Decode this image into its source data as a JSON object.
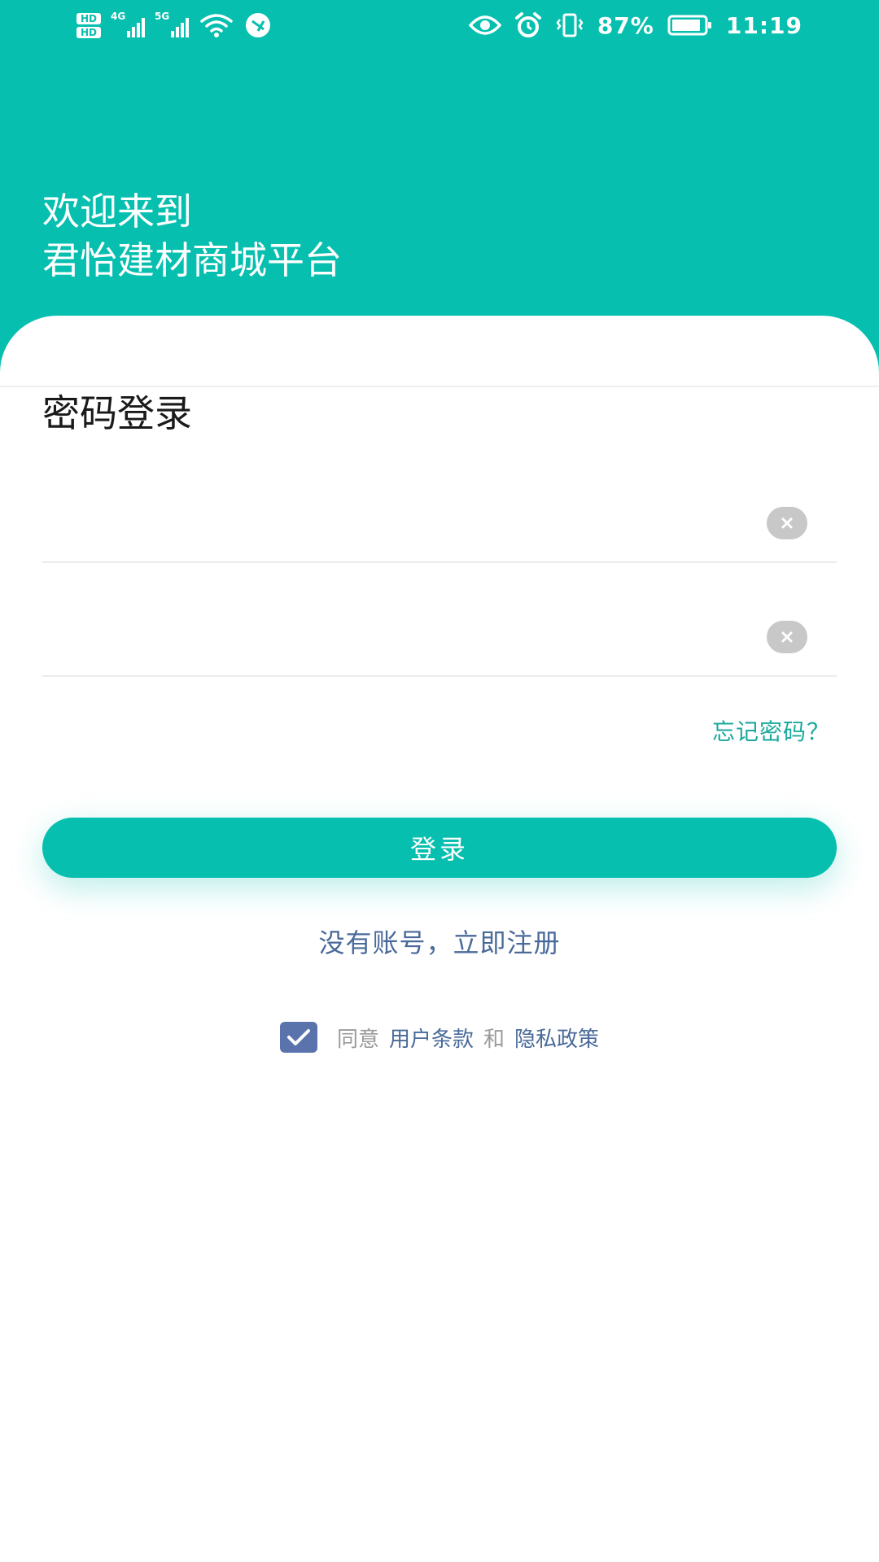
{
  "status_bar": {
    "hd1": "HD",
    "hd2": "HD",
    "net1": "4G",
    "net2": "5G",
    "battery": "87%",
    "time": "11:19"
  },
  "header": {
    "welcome_line1": "欢迎来到",
    "welcome_line2": "君怡建材商城平台"
  },
  "login": {
    "title": "密码登录",
    "account_value": "",
    "password_value": "",
    "forgot_label": "忘记密码？",
    "submit_label": "登录",
    "register_label": "没有账号，立即注册"
  },
  "agreement": {
    "checked": true,
    "agree_text": "同意",
    "terms_label": "用户条款",
    "and_text": "和",
    "privacy_label": "隐私政策"
  },
  "colors": {
    "primary": "#06bfaf",
    "link": "#4a6a9a",
    "checkbox": "#5a73ad"
  }
}
